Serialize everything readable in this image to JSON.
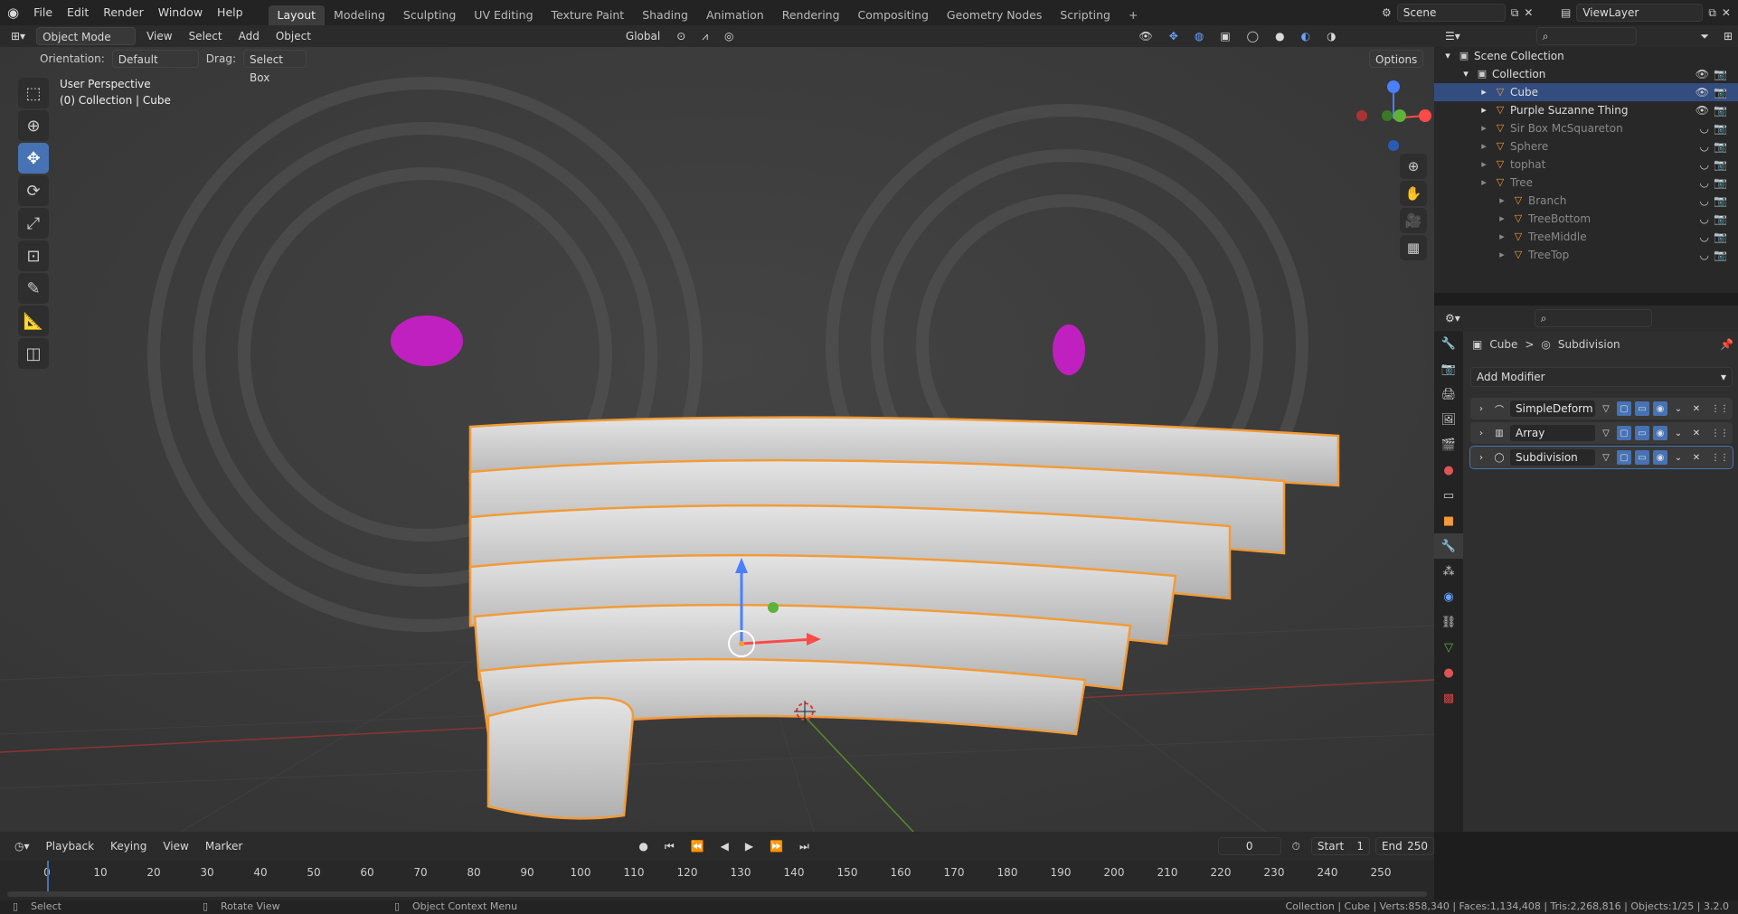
{
  "topbar": {
    "menus": [
      "File",
      "Edit",
      "Render",
      "Window",
      "Help"
    ],
    "workspaces": [
      "Layout",
      "Modeling",
      "Sculpting",
      "UV Editing",
      "Texture Paint",
      "Shading",
      "Animation",
      "Rendering",
      "Compositing",
      "Geometry Nodes",
      "Scripting"
    ],
    "add_tab": "+",
    "scene": "Scene",
    "view_layer": "ViewLayer"
  },
  "viewport": {
    "mode": "Object Mode",
    "menus": [
      "View",
      "Select",
      "Add",
      "Object"
    ],
    "transform": "Global",
    "orientation_label": "Orientation:",
    "orientation": "Default",
    "drag_label": "Drag:",
    "drag": "Select Box",
    "options": "Options",
    "overlay_title": "User Perspective",
    "overlay_sub": "(0) Collection | Cube"
  },
  "outliner": {
    "rows": [
      {
        "label": "Scene Collection",
        "indent": 0
      },
      {
        "label": "Collection",
        "indent": 1
      },
      {
        "label": "Cube",
        "indent": 2,
        "selected": true
      },
      {
        "label": "Purple Suzanne Thing",
        "indent": 2
      },
      {
        "label": "Sir Box McSquareton",
        "indent": 2,
        "dim": true
      },
      {
        "label": "Sphere",
        "indent": 2,
        "dim": true
      },
      {
        "label": "tophat",
        "indent": 2,
        "dim": true
      },
      {
        "label": "Tree",
        "indent": 2,
        "dim": true
      },
      {
        "label": "Branch",
        "indent": 3,
        "dim": true
      },
      {
        "label": "TreeBottom",
        "indent": 3,
        "dim": true
      },
      {
        "label": "TreeMiddle",
        "indent": 3,
        "dim": true
      },
      {
        "label": "TreeTop",
        "indent": 3,
        "dim": true
      }
    ]
  },
  "properties": {
    "breadcrumb_object": "Cube",
    "breadcrumb_sep": ">",
    "breadcrumb_modifier": "Subdivision",
    "add_modifier": "Add Modifier",
    "modifiers": [
      "SimpleDeform",
      "Array",
      "Subdivision"
    ]
  },
  "timeline": {
    "menus": [
      "Playback",
      "Keying",
      "View",
      "Marker"
    ],
    "current_frame": "0",
    "start_label": "Start",
    "start": "1",
    "end_label": "End",
    "end": "250",
    "ticks": [
      "0",
      "10",
      "20",
      "30",
      "40",
      "50",
      "60",
      "70",
      "80",
      "90",
      "100",
      "110",
      "120",
      "130",
      "140",
      "150",
      "160",
      "170",
      "180",
      "190",
      "200",
      "210",
      "220",
      "230",
      "240",
      "250"
    ]
  },
  "status": {
    "select": "Select",
    "rotate": "Rotate View",
    "context": "Object Context Menu",
    "stats": "Collection | Cube | Verts:858,340 | Faces:1,134,408 | Tris:2,268,816 | Objects:1/25 | 3.2.0"
  },
  "colors": {
    "accent": "#4772b3",
    "selection_outline": "#f29b38",
    "suzanne": "#c020c0"
  }
}
